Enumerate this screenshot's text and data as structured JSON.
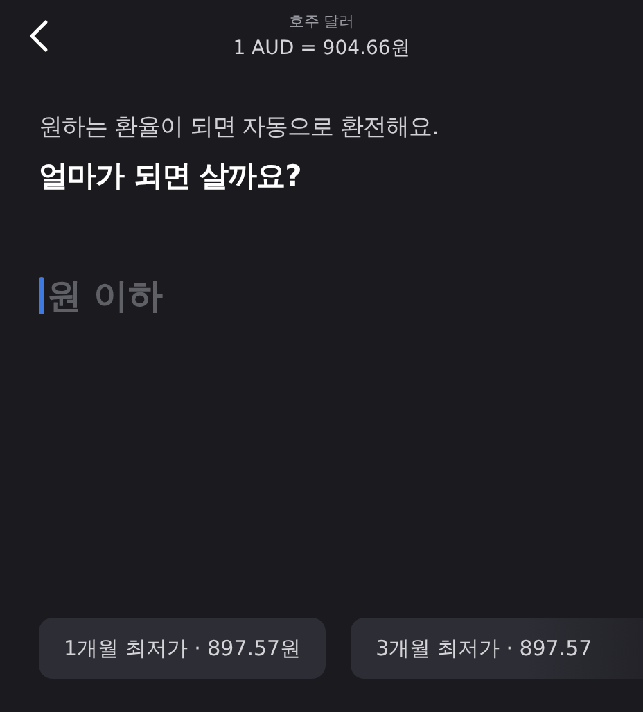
{
  "header": {
    "currency": "호주 달러",
    "rate": "1 AUD = 904.66원"
  },
  "intro": {
    "description": "원하는 환율이 되면 자동으로 환전해요.",
    "question": "얼마가 되면 살까요?"
  },
  "price_field": {
    "placeholder": "원 이하"
  },
  "suggestions": [
    {
      "label": "1개월 최저가 · 897.57원"
    },
    {
      "label": "3개월 최저가 · 897.57"
    }
  ]
}
